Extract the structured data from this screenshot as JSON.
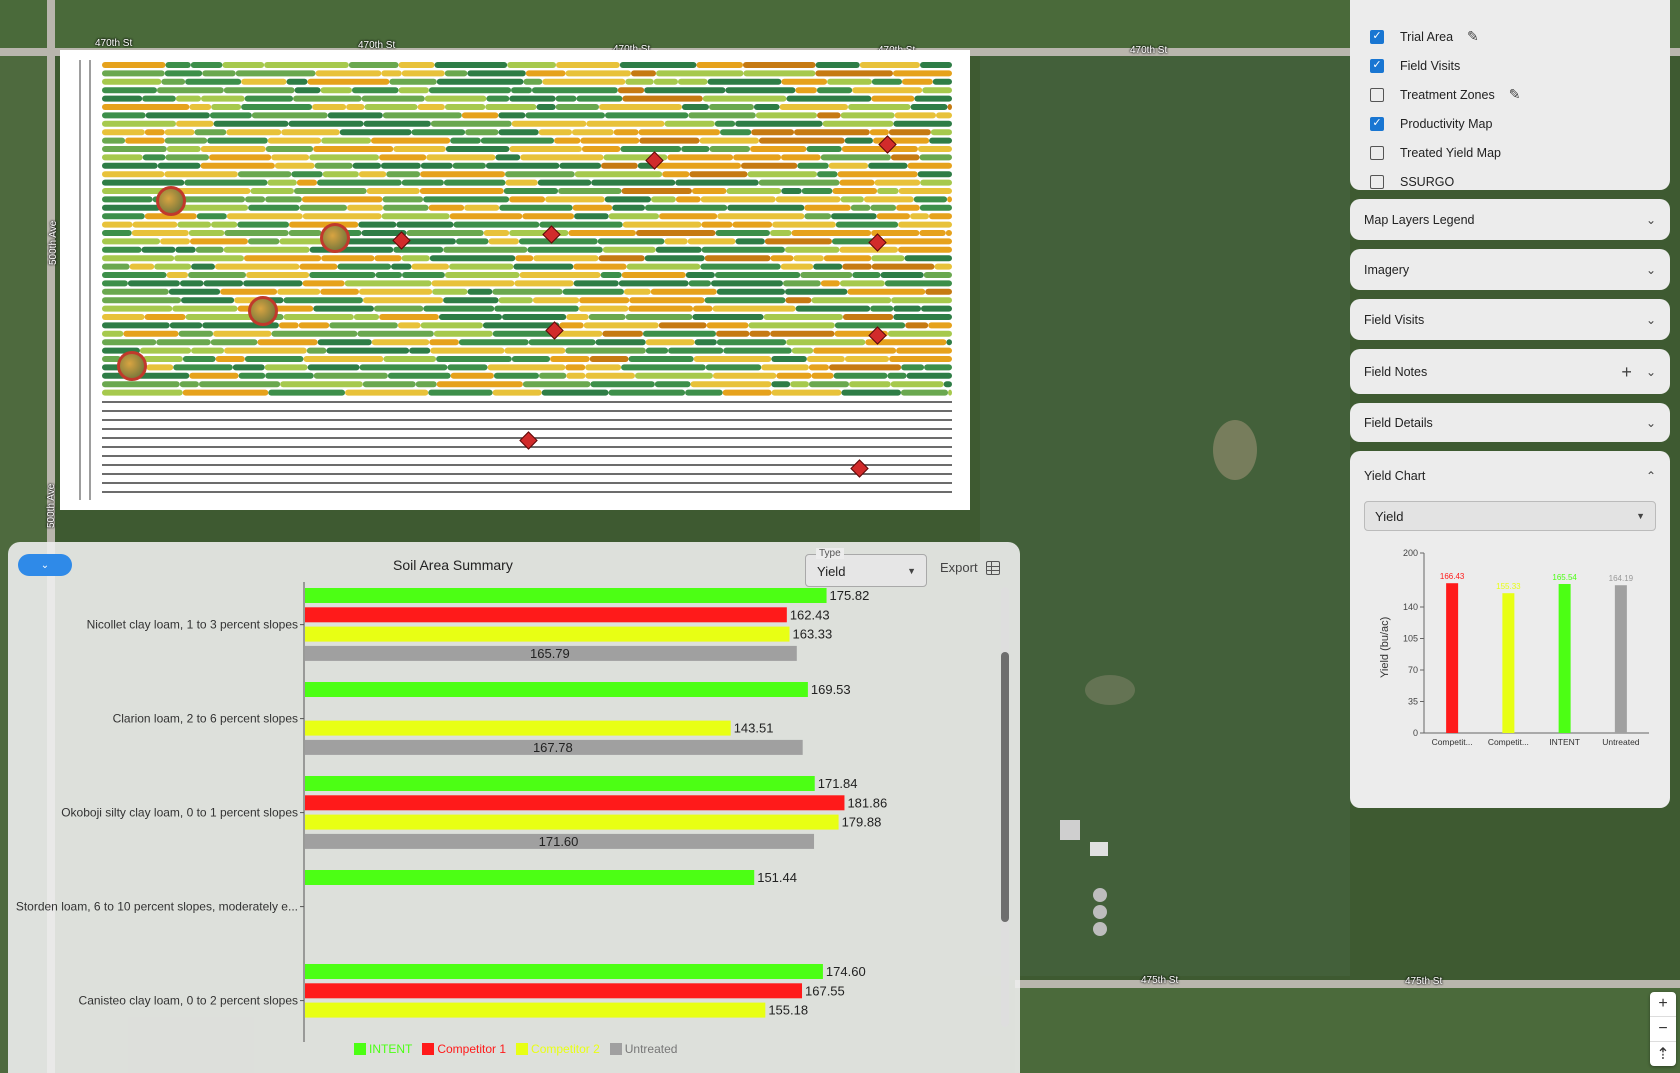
{
  "map": {
    "roads": [
      "470th St",
      "470th St",
      "470th St",
      "470th St",
      "470th St",
      "500th Ave",
      "500th Ave",
      "475th St",
      "475th St"
    ]
  },
  "layers": {
    "items": [
      {
        "label": "Trial Area",
        "checked": true,
        "editable": true
      },
      {
        "label": "Field Visits",
        "checked": true,
        "editable": false
      },
      {
        "label": "Treatment Zones",
        "checked": false,
        "editable": true
      },
      {
        "label": "Productivity Map",
        "checked": true,
        "editable": false
      },
      {
        "label": "Treated Yield Map",
        "checked": false,
        "editable": false
      },
      {
        "label": "SSURGO",
        "checked": false,
        "editable": false
      }
    ]
  },
  "accordions": [
    {
      "label": "Map Layers Legend"
    },
    {
      "label": "Imagery"
    },
    {
      "label": "Field Visits"
    },
    {
      "label": "Field Notes"
    },
    {
      "label": "Field Details"
    }
  ],
  "yield_chart": {
    "title": "Yield Chart",
    "select_value": "Yield"
  },
  "soil_panel": {
    "title": "Soil Area Summary",
    "type_label": "Type",
    "type_value": "Yield",
    "export_label": "Export"
  },
  "colors": {
    "intent": "#4cff14",
    "competitor1": "#ff1a1a",
    "competitor2": "#e8ff14",
    "untreated": "#a0a0a0"
  },
  "chart_data": [
    {
      "type": "bar",
      "orientation": "horizontal",
      "title": "Soil Area Summary",
      "categories": [
        "Nicollet clay loam, 1 to 3 percent slopes",
        "Clarion loam, 2 to 6 percent slopes",
        "Okoboji silty clay loam, 0 to 1 percent slopes",
        "Storden loam, 6 to 10 percent slopes, moderately e...",
        "Canisteo clay loam, 0 to 2 percent slopes"
      ],
      "series": [
        {
          "name": "INTENT",
          "values": [
            175.82,
            169.53,
            171.84,
            151.44,
            174.6
          ]
        },
        {
          "name": "Competitor 1",
          "values": [
            162.43,
            null,
            181.86,
            null,
            167.55
          ]
        },
        {
          "name": "Competitor 2",
          "values": [
            163.33,
            143.51,
            179.88,
            null,
            155.18
          ]
        },
        {
          "name": "Untreated",
          "values": [
            165.79,
            167.78,
            171.6,
            null,
            null
          ]
        }
      ],
      "value_labels": [
        [
          "175.82",
          "169.53",
          "171.84",
          "151.44",
          "174.60"
        ],
        [
          "162.43",
          "",
          "181.86",
          "",
          "167.55"
        ],
        [
          "163.33",
          "143.51",
          "179.88",
          "",
          "155.18"
        ],
        [
          "165.79",
          "167.78",
          "171.60",
          "",
          ""
        ]
      ],
      "xlim": [
        0,
        200
      ],
      "legend": "bottom"
    },
    {
      "type": "bar",
      "title": "Yield Chart",
      "ylabel": "Yield (bu/ac)",
      "categories": [
        "Competit...",
        "Competit...",
        "INTENT",
        "Untreated"
      ],
      "values": [
        166.43,
        155.33,
        165.54,
        164.19
      ],
      "value_labels": [
        "166.43",
        "155.33",
        "165.54",
        "164.19"
      ],
      "ylim": [
        0,
        200
      ],
      "yticks": [
        0,
        35,
        70,
        105,
        140,
        200
      ],
      "ytick_labels": [
        "0",
        "35",
        "70",
        "105",
        "140",
        "200"
      ]
    }
  ],
  "zoom": {
    "in": "+",
    "out": "−",
    "reset": "⇡"
  }
}
